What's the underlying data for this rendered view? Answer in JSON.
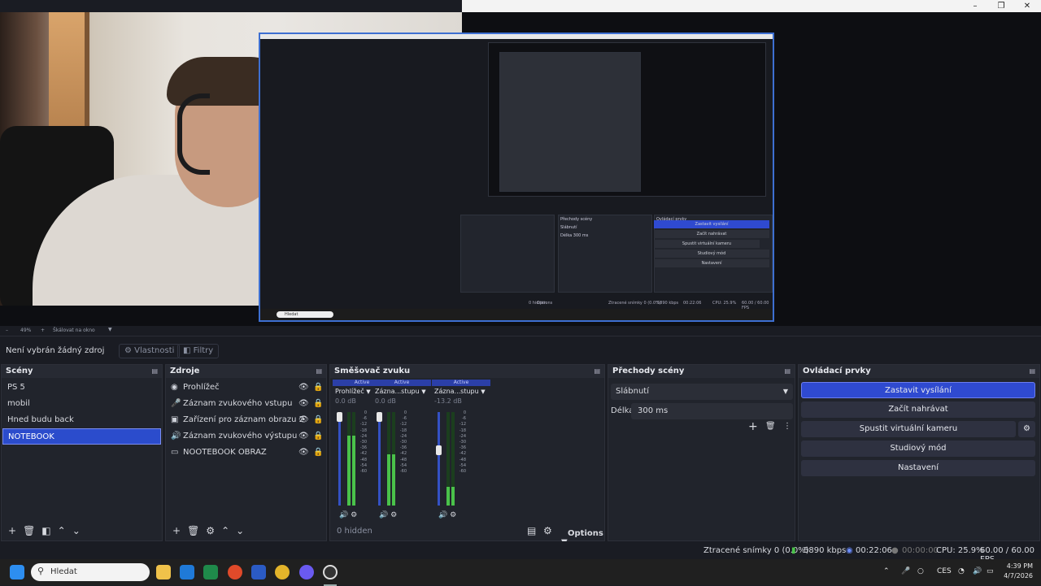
{
  "preview": {
    "nested_buttons": [
      "Zastavit vysílání",
      "Začít nahrávat",
      "Spustit virtuální kameru",
      "Studiový mód",
      "Nastavení"
    ],
    "nested_panels": {
      "transitions": "Přechody scény",
      "controls": "Ovládací prvky",
      "transition_value": "Slábnutí",
      "duration_label": "Délka",
      "duration_value": "300 ms"
    },
    "nested_status": {
      "dropped": "Ztracené snímky 0 (0.0%)",
      "kbps": "5890 kbps",
      "time": "00:22:06",
      "cpu": "CPU: 25.9%",
      "fps": "60.00 / 60.00 FPS"
    },
    "nested_taskbar_search": "Hledat",
    "nested_options": "Options",
    "nested_hidden": "0 hidden"
  },
  "scalebar": {
    "zoom": "49%",
    "mode": "Škálovat na okno"
  },
  "context": {
    "no_source": "Není vybrán žádný zdroj",
    "properties": "Vlastnosti",
    "filters": "Filtry"
  },
  "scenes": {
    "title": "Scény",
    "items": [
      "PS 5",
      "mobil",
      "Hned budu back",
      "NOTEBOOK"
    ],
    "selected_index": 3
  },
  "sources": {
    "title": "Zdroje",
    "items": [
      {
        "label": "Prohlížeč",
        "icon": "browser-icon"
      },
      {
        "label": "Záznam zvukového vstupu",
        "icon": "microphone-icon"
      },
      {
        "label": "Zařízení pro záznam obrazu 2",
        "icon": "camera-icon"
      },
      {
        "label": "Záznam zvukového výstupu",
        "icon": "speaker-icon"
      },
      {
        "label": "NOOTEBOOK OBRAZ",
        "icon": "monitor-icon"
      }
    ]
  },
  "mixer": {
    "title": "Směšovač zvuku",
    "channels": [
      {
        "active": "Active",
        "name": "Prohlížeč",
        "db": "0.0 dB",
        "level": 0.75,
        "fader": 1.0
      },
      {
        "active": "Active",
        "name": "Zázna...stupu",
        "db": "0.0 dB",
        "level": 0.55,
        "fader": 1.0
      },
      {
        "active": "Active",
        "name": "Zázna...stupu",
        "db": "-13.2 dB",
        "level": 0.2,
        "fader": 0.6
      }
    ],
    "scale": [
      "0",
      "-6",
      "-12",
      "-18",
      "-24",
      "-30",
      "-36",
      "-42",
      "-48",
      "-54",
      "-60"
    ],
    "hidden": "0 hidden",
    "options": "Options"
  },
  "transitions": {
    "title": "Přechody scény",
    "selected": "Slábnutí",
    "duration_label": "Délka",
    "duration_value": "300 ms"
  },
  "controls": {
    "title": "Ovládací prvky",
    "stop_stream": "Zastavit vysílání",
    "start_record": "Začít nahrávat",
    "virtual_cam": "Spustit virtuální kameru",
    "studio_mode": "Studiový mód",
    "settings": "Nastavení"
  },
  "status": {
    "dropped": "Ztracené snímky 0 (0.0%)",
    "kbps": "5890 kbps",
    "stream_time": "00:22:06",
    "record_time": "00:00:00",
    "cpu": "CPU: 25.9%",
    "fps": "60.00 / 60.00 FPS"
  },
  "taskbar": {
    "search": "Hledat",
    "lang": "CES",
    "time": "4:39 PM",
    "date": "4/7/2026"
  },
  "colors": {
    "accent": "#2f4ad0",
    "panel": "#21242c",
    "background": "#1a1c23",
    "meter_green": "#4ac24a"
  }
}
